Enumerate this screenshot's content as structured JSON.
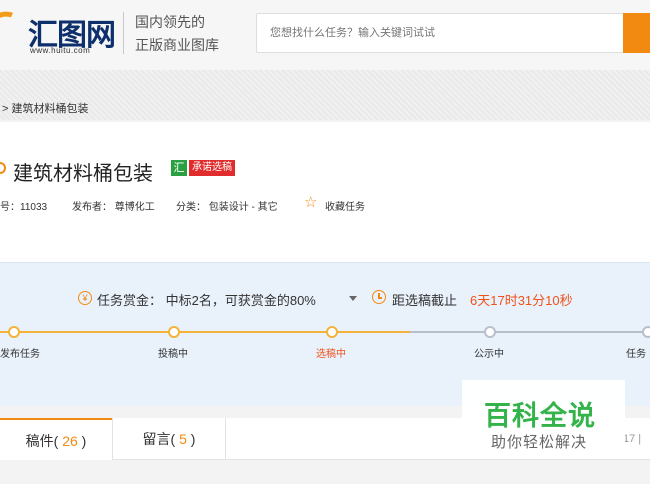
{
  "header": {
    "logo_text": "汇图网",
    "logo_url": "www.huitu.com",
    "slogan_line1": "国内领先的",
    "slogan_line2": "正版商业图库",
    "search_placeholder": "您想找什么任务？输入关键词试试"
  },
  "breadcrumb": {
    "text": "> 建筑材料桶包装"
  },
  "task": {
    "title": "建筑材料桶包装",
    "badge_hui": "喵",
    "badge_promise": "承诺选稿",
    "meta": {
      "id_label": "号：11033",
      "publisher": "发布者： 尊博化工",
      "category": "分类： 包装设计 - 其它",
      "favorite": "收藏任务"
    }
  },
  "reward": {
    "icon_char": "¥",
    "text": "任务赏金： 中标2名，可获赏金的80%",
    "deadline_label": "距选稿截止",
    "deadline_value": "6天17时31分10秒"
  },
  "progress": {
    "current_step": 3,
    "steps": [
      {
        "label": "发布任务"
      },
      {
        "label": "投稿中"
      },
      {
        "label": "选稿中"
      },
      {
        "label": "公示中"
      },
      {
        "label": "任务"
      }
    ]
  },
  "tabs": [
    {
      "label": "稿件(",
      "count": " 26 ",
      "suffix": ")"
    },
    {
      "label": "留言(",
      "count": " 5 ",
      "suffix": ")"
    }
  ],
  "pager": {
    "text": "17 |"
  },
  "watermark": {
    "title": "百科全说",
    "subtitle": "助你轻松解决"
  },
  "colors": {
    "accent": "#f28a12",
    "deadline": "#f0511b",
    "progress_done": "#f4b23a",
    "progress_todo": "#b9bfc8",
    "watermark_green": "#33b34a"
  }
}
